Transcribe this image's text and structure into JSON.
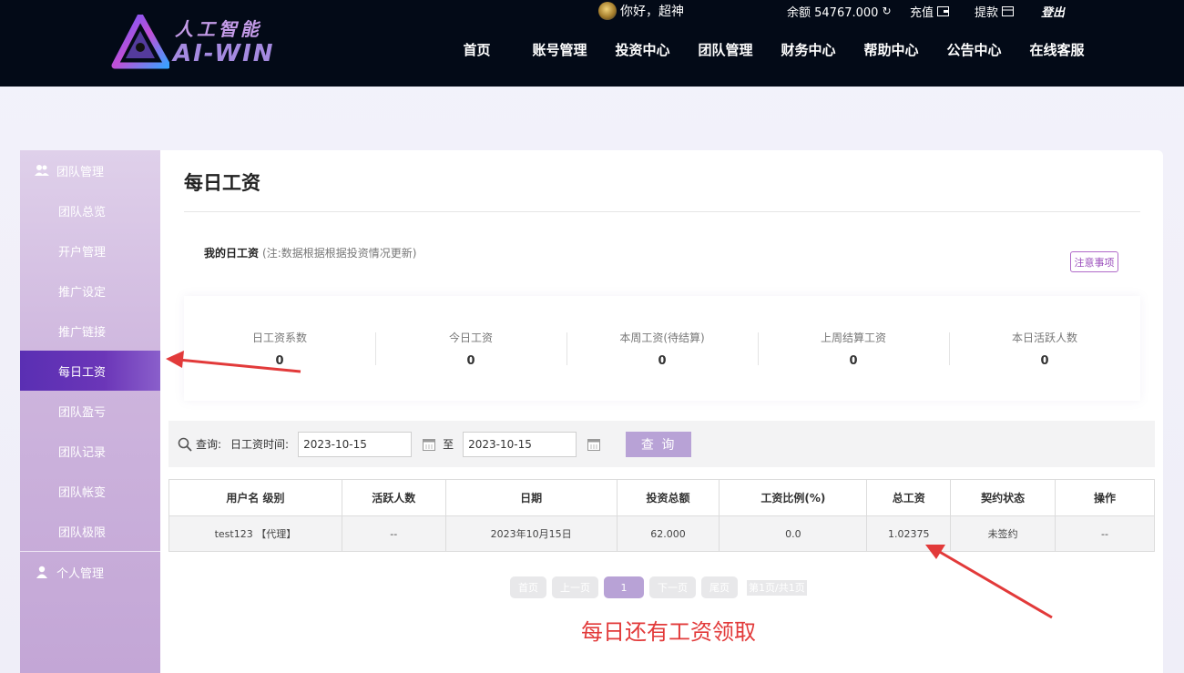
{
  "header": {
    "logo_cn": "人工智能",
    "logo_en": "AI-WIN",
    "greeting": "你好，超神",
    "balance": "余额 54767.000",
    "recharge": "充值",
    "withdraw": "提款",
    "logout": "登出",
    "nav": [
      "首页",
      "账号管理",
      "投资中心",
      "团队管理",
      "财务中心",
      "帮助中心",
      "公告中心",
      "在线客服"
    ]
  },
  "sidebar": {
    "groups": [
      {
        "label": "团队管理",
        "icon": "team-icon",
        "items": [
          {
            "label": "团队总览"
          },
          {
            "label": "开户管理"
          },
          {
            "label": "推广设定"
          },
          {
            "label": "推广链接"
          },
          {
            "label": "每日工资",
            "active": true
          },
          {
            "label": "团队盈亏"
          },
          {
            "label": "团队记录"
          },
          {
            "label": "团队帐变"
          },
          {
            "label": "团队极限"
          }
        ]
      },
      {
        "label": "个人管理",
        "icon": "user-icon",
        "items": []
      }
    ]
  },
  "main": {
    "title": "每日工资",
    "subtitle": "我的日工资",
    "subtitle_note": "(注:数据根据根据投资情况更新)",
    "notice_button": "注意事项",
    "stats": [
      {
        "label": "日工资系数",
        "value": "0"
      },
      {
        "label": "今日工资",
        "value": "0"
      },
      {
        "label": "本周工资(待结算)",
        "value": "0"
      },
      {
        "label": "上周结算工资",
        "value": "0"
      },
      {
        "label": "本日活跃人数",
        "value": "0"
      }
    ],
    "query": {
      "prefix": "查询:",
      "label": "日工资时间:",
      "from": "2023-10-15",
      "to_label": "至",
      "to": "2023-10-15",
      "button": "查 询"
    },
    "table": {
      "headers": [
        "用户名 级别",
        "活跃人数",
        "日期",
        "投资总额",
        "工资比例(%)",
        "总工资",
        "契约状态",
        "操作"
      ],
      "rows": [
        [
          "test123 【代理】",
          "--",
          "2023年10月15日",
          "62.000",
          "0.0",
          "1.02375",
          "未签约",
          "--"
        ]
      ]
    },
    "pager": {
      "first": "首页",
      "prev": "上一页",
      "current": "1",
      "next": "下一页",
      "last": "尾页",
      "info": "第1页/共1页"
    },
    "annotation": "每日还有工资领取"
  },
  "colors": {
    "header_bg": "#030a17",
    "accent": "#5a2fb3",
    "button": "#b8a2d6",
    "annotation": "#e23a3a"
  }
}
